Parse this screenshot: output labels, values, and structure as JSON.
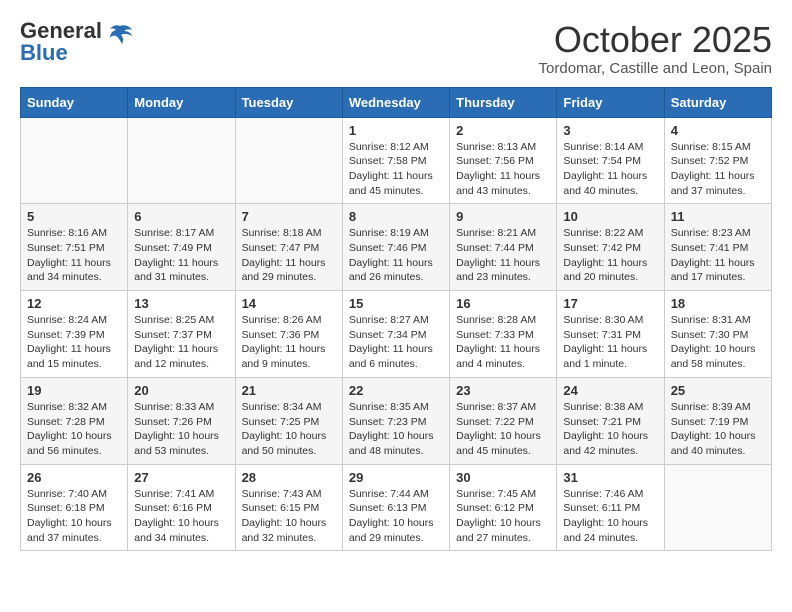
{
  "header": {
    "logo_general": "General",
    "logo_blue": "Blue",
    "month_title": "October 2025",
    "location": "Tordomar, Castille and Leon, Spain"
  },
  "weekdays": [
    "Sunday",
    "Monday",
    "Tuesday",
    "Wednesday",
    "Thursday",
    "Friday",
    "Saturday"
  ],
  "weeks": [
    [
      {
        "day": "",
        "info": ""
      },
      {
        "day": "",
        "info": ""
      },
      {
        "day": "",
        "info": ""
      },
      {
        "day": "1",
        "info": "Sunrise: 8:12 AM\nSunset: 7:58 PM\nDaylight: 11 hours\nand 45 minutes."
      },
      {
        "day": "2",
        "info": "Sunrise: 8:13 AM\nSunset: 7:56 PM\nDaylight: 11 hours\nand 43 minutes."
      },
      {
        "day": "3",
        "info": "Sunrise: 8:14 AM\nSunset: 7:54 PM\nDaylight: 11 hours\nand 40 minutes."
      },
      {
        "day": "4",
        "info": "Sunrise: 8:15 AM\nSunset: 7:52 PM\nDaylight: 11 hours\nand 37 minutes."
      }
    ],
    [
      {
        "day": "5",
        "info": "Sunrise: 8:16 AM\nSunset: 7:51 PM\nDaylight: 11 hours\nand 34 minutes."
      },
      {
        "day": "6",
        "info": "Sunrise: 8:17 AM\nSunset: 7:49 PM\nDaylight: 11 hours\nand 31 minutes."
      },
      {
        "day": "7",
        "info": "Sunrise: 8:18 AM\nSunset: 7:47 PM\nDaylight: 11 hours\nand 29 minutes."
      },
      {
        "day": "8",
        "info": "Sunrise: 8:19 AM\nSunset: 7:46 PM\nDaylight: 11 hours\nand 26 minutes."
      },
      {
        "day": "9",
        "info": "Sunrise: 8:21 AM\nSunset: 7:44 PM\nDaylight: 11 hours\nand 23 minutes."
      },
      {
        "day": "10",
        "info": "Sunrise: 8:22 AM\nSunset: 7:42 PM\nDaylight: 11 hours\nand 20 minutes."
      },
      {
        "day": "11",
        "info": "Sunrise: 8:23 AM\nSunset: 7:41 PM\nDaylight: 11 hours\nand 17 minutes."
      }
    ],
    [
      {
        "day": "12",
        "info": "Sunrise: 8:24 AM\nSunset: 7:39 PM\nDaylight: 11 hours\nand 15 minutes."
      },
      {
        "day": "13",
        "info": "Sunrise: 8:25 AM\nSunset: 7:37 PM\nDaylight: 11 hours\nand 12 minutes."
      },
      {
        "day": "14",
        "info": "Sunrise: 8:26 AM\nSunset: 7:36 PM\nDaylight: 11 hours\nand 9 minutes."
      },
      {
        "day": "15",
        "info": "Sunrise: 8:27 AM\nSunset: 7:34 PM\nDaylight: 11 hours\nand 6 minutes."
      },
      {
        "day": "16",
        "info": "Sunrise: 8:28 AM\nSunset: 7:33 PM\nDaylight: 11 hours\nand 4 minutes."
      },
      {
        "day": "17",
        "info": "Sunrise: 8:30 AM\nSunset: 7:31 PM\nDaylight: 11 hours\nand 1 minute."
      },
      {
        "day": "18",
        "info": "Sunrise: 8:31 AM\nSunset: 7:30 PM\nDaylight: 10 hours\nand 58 minutes."
      }
    ],
    [
      {
        "day": "19",
        "info": "Sunrise: 8:32 AM\nSunset: 7:28 PM\nDaylight: 10 hours\nand 56 minutes."
      },
      {
        "day": "20",
        "info": "Sunrise: 8:33 AM\nSunset: 7:26 PM\nDaylight: 10 hours\nand 53 minutes."
      },
      {
        "day": "21",
        "info": "Sunrise: 8:34 AM\nSunset: 7:25 PM\nDaylight: 10 hours\nand 50 minutes."
      },
      {
        "day": "22",
        "info": "Sunrise: 8:35 AM\nSunset: 7:23 PM\nDaylight: 10 hours\nand 48 minutes."
      },
      {
        "day": "23",
        "info": "Sunrise: 8:37 AM\nSunset: 7:22 PM\nDaylight: 10 hours\nand 45 minutes."
      },
      {
        "day": "24",
        "info": "Sunrise: 8:38 AM\nSunset: 7:21 PM\nDaylight: 10 hours\nand 42 minutes."
      },
      {
        "day": "25",
        "info": "Sunrise: 8:39 AM\nSunset: 7:19 PM\nDaylight: 10 hours\nand 40 minutes."
      }
    ],
    [
      {
        "day": "26",
        "info": "Sunrise: 7:40 AM\nSunset: 6:18 PM\nDaylight: 10 hours\nand 37 minutes."
      },
      {
        "day": "27",
        "info": "Sunrise: 7:41 AM\nSunset: 6:16 PM\nDaylight: 10 hours\nand 34 minutes."
      },
      {
        "day": "28",
        "info": "Sunrise: 7:43 AM\nSunset: 6:15 PM\nDaylight: 10 hours\nand 32 minutes."
      },
      {
        "day": "29",
        "info": "Sunrise: 7:44 AM\nSunset: 6:13 PM\nDaylight: 10 hours\nand 29 minutes."
      },
      {
        "day": "30",
        "info": "Sunrise: 7:45 AM\nSunset: 6:12 PM\nDaylight: 10 hours\nand 27 minutes."
      },
      {
        "day": "31",
        "info": "Sunrise: 7:46 AM\nSunset: 6:11 PM\nDaylight: 10 hours\nand 24 minutes."
      },
      {
        "day": "",
        "info": ""
      }
    ]
  ]
}
